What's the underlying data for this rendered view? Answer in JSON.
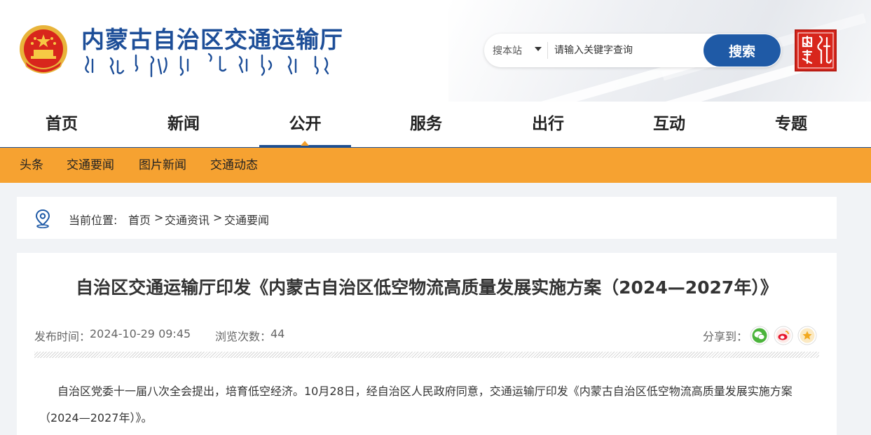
{
  "header": {
    "site_title": "内蒙古自治区交通运输厅",
    "search_scope": "搜本站",
    "search_placeholder": "请输入关键字查询",
    "search_button": "搜索"
  },
  "main_nav": {
    "items": [
      {
        "label": "首页"
      },
      {
        "label": "新闻"
      },
      {
        "label": "公开"
      },
      {
        "label": "服务"
      },
      {
        "label": "出行"
      },
      {
        "label": "互动"
      },
      {
        "label": "专题"
      }
    ],
    "active": "公开"
  },
  "sub_nav": {
    "items": [
      {
        "label": "头条"
      },
      {
        "label": "交通要闻"
      },
      {
        "label": "图片新闻"
      },
      {
        "label": "交通动态"
      }
    ]
  },
  "breadcrumb": {
    "prefix": "当前位置:",
    "items": [
      "首页",
      "交通资讯",
      "交通要闻"
    ],
    "separator": ">"
  },
  "article": {
    "title": "自治区交通运输厅印发《内蒙古自治区低空物流高质量发展实施方案（2024—2027年）》",
    "publish_label": "发布时间：",
    "publish_time": "2024-10-29 09:45",
    "views_label": "浏览次数：",
    "views": "44",
    "share_label": "分享到：",
    "paragraph1_line1": "自治区党委十一届八次全会提出，培育低空经济。10月28日，经自治区人民政府同意，交通运输厅印发《内蒙古自治区低空物流高质量发展实施方案",
    "paragraph1_line2": "（2024—2027年）》。"
  },
  "colors": {
    "brand_blue": "#1d4e98",
    "search_button": "#1f5aa6",
    "sub_nav_bg": "#f6a231",
    "share_wechat": "#4cb43c",
    "share_weibo": "#e6162d",
    "share_favorite": "#f2a91f"
  },
  "icons": [
    "national-emblem-icon",
    "chevron-down-icon",
    "seal-logo-icon",
    "location-pin-icon",
    "wechat-icon",
    "weibo-icon",
    "star-favorite-icon"
  ]
}
